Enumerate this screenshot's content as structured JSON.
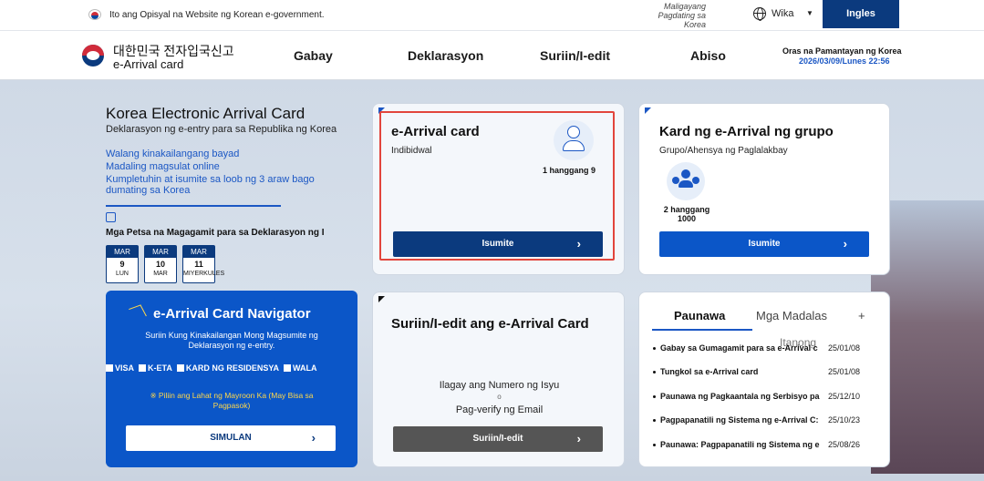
{
  "govbar": {
    "text": "Ito ang Opisyal na Website ng Korean e-government.",
    "tagline": "Maligayang Pagdating sa Korea",
    "language_label": "Wika",
    "language_button": "Ingles"
  },
  "header": {
    "logo_kr": "대한민국 전자입국신고",
    "logo_en": "e-Arrival card",
    "nav": [
      "Gabay",
      "Deklarasyon",
      "Suriin/I-edit",
      "Abiso"
    ],
    "clock_label": "Oras na Pamantayan ng Korea",
    "clock_value": "2026/03/09/Lunes 22:56"
  },
  "hero": {
    "title": "Korea Electronic Arrival Card",
    "subtitle": "Deklarasyon ng e-entry para sa Republika ng Korea",
    "features": [
      "Walang kinakailangang bayad",
      "Madaling magsulat online",
      "Kumpletuhin at isumite sa loob ng 3 araw bago dumating sa Korea"
    ],
    "dates_title": "Mga Petsa na Magagamit para sa Deklarasyon ng I",
    "dates": [
      {
        "month": "MAR",
        "day": "9",
        "weekday": "LUN"
      },
      {
        "month": "MAR",
        "day": "10",
        "weekday": "MAR"
      },
      {
        "month": "MAR",
        "day": "11",
        "weekday": "MIYERKULES"
      }
    ]
  },
  "individual_card": {
    "title": "e-Arrival card",
    "subtitle": "Indibidwal",
    "count": "1 hanggang 9",
    "button": "Isumite",
    "icon": "person-icon"
  },
  "group_card": {
    "title": "Kard ng e-Arrival ng grupo",
    "subtitle": "Grupo/Ahensya ng Paglalakbay",
    "count": "2 hanggang 1000",
    "button": "Isumite",
    "icon": "group-icon"
  },
  "edit_card": {
    "title": "Suriin/I-edit ang e-Arrival Card",
    "line1": "Ilagay ang Numero ng Isyu",
    "line2": "o",
    "line3": "Pag-verify ng Email",
    "button": "Suriin/I-edit"
  },
  "navigator": {
    "title": "e-Arrival Card Navigator",
    "description": "Suriin Kung Kinakailangan Mong Magsumite ng Deklarasyon ng e-entry.",
    "options": [
      "VISA",
      "K-ETA",
      "KARD NG RESIDENSYA",
      "WALA"
    ],
    "note": "※ Piliin ang Lahat ng Mayroon Ka (May Bisa sa Pagpasok)",
    "button": "SIMULAN"
  },
  "notice": {
    "tab_active": "Paunawa",
    "tab_inactive": "Mga Madalas",
    "tab_overlap": "Itanong",
    "plus": "+",
    "items": [
      {
        "title": "Gabay sa Gumagamit para sa e-Arrival c",
        "date": "25/01/08"
      },
      {
        "title": "Tungkol sa e-Arrival card",
        "date": "25/01/08"
      },
      {
        "title": "Paunawa ng Pagkaantala ng Serbisyo pa",
        "date": "25/12/10"
      },
      {
        "title": "Pagpapanatili ng Sistema ng e-Arrival C:",
        "date": "25/10/23"
      },
      {
        "title": "Paunawa: Pagpapanatili ng Sistema ng e",
        "date": "25/08/26"
      }
    ]
  },
  "colors": {
    "primary": "#0b3a7e",
    "accent": "#1b57c4",
    "navigator": "#0b56c8",
    "highlight": "#e2453c",
    "edit_button": "#555555"
  }
}
